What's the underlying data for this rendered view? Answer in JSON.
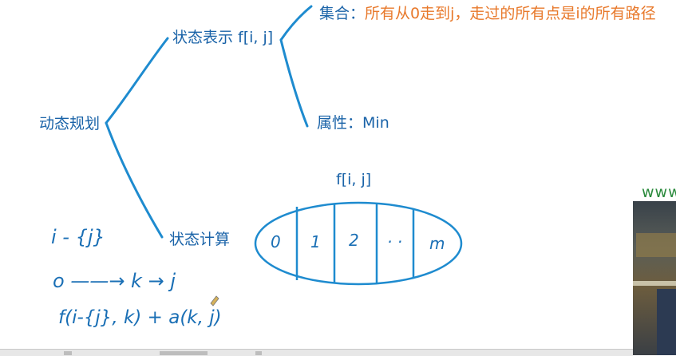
{
  "root_label": "动态规划",
  "state_repr": "状态表示 f[i, j]",
  "state_set": {
    "key": "集合：",
    "value": "所有从0走到j，走过的所有点是i的所有路径"
  },
  "state_attr": {
    "key": "属性：",
    "value": "Min"
  },
  "state_calc": "状态计算",
  "ellipse_title": "f[i, j]",
  "partitions": [
    "0",
    "1",
    "2",
    "· ·",
    "m"
  ],
  "handwritten": {
    "line1": "i - {j}",
    "line2": "o ——→ k → j",
    "line3": "f(i-{j}, k) + a(k, j)"
  },
  "watermark": "www",
  "colors": {
    "branch": "#1e8bcf",
    "ink": "#1a6fb5",
    "text": "#1a63a8",
    "accent": "#e8792b"
  }
}
